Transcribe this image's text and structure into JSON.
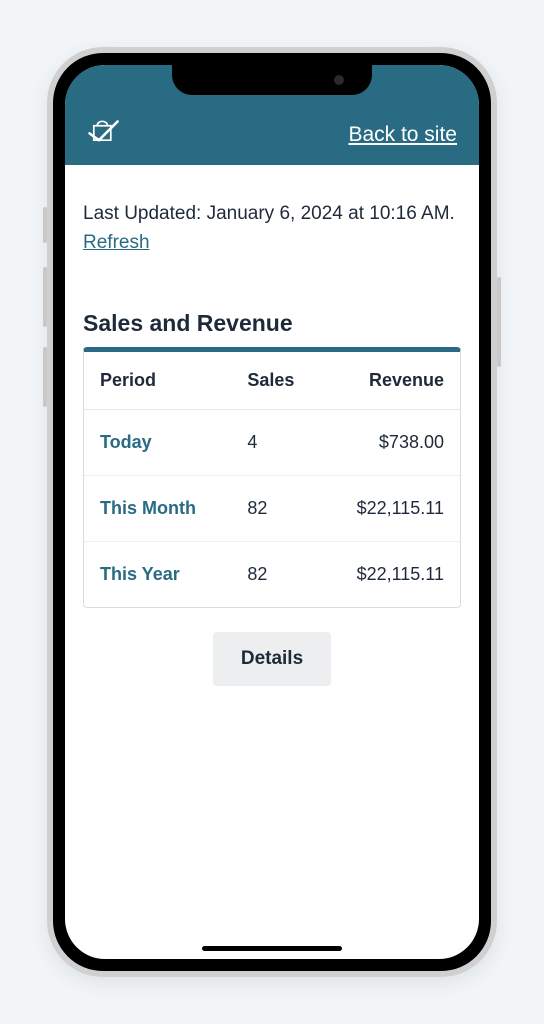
{
  "header": {
    "back_label": "Back to site"
  },
  "status": {
    "last_updated": "Last Updated: January 6, 2024 at 10:16 AM.",
    "refresh_label": "Refresh"
  },
  "section": {
    "title": "Sales and Revenue"
  },
  "table": {
    "headers": {
      "period": "Period",
      "sales": "Sales",
      "revenue": "Revenue"
    },
    "rows": [
      {
        "period": "Today",
        "sales": "4",
        "revenue": "$738.00"
      },
      {
        "period": "This Month",
        "sales": "82",
        "revenue": "$22,115.11"
      },
      {
        "period": "This Year",
        "sales": "82",
        "revenue": "$22,115.11"
      }
    ]
  },
  "details_label": "Details",
  "colors": {
    "brand": "#2a6b84",
    "text": "#1e2a3a"
  }
}
